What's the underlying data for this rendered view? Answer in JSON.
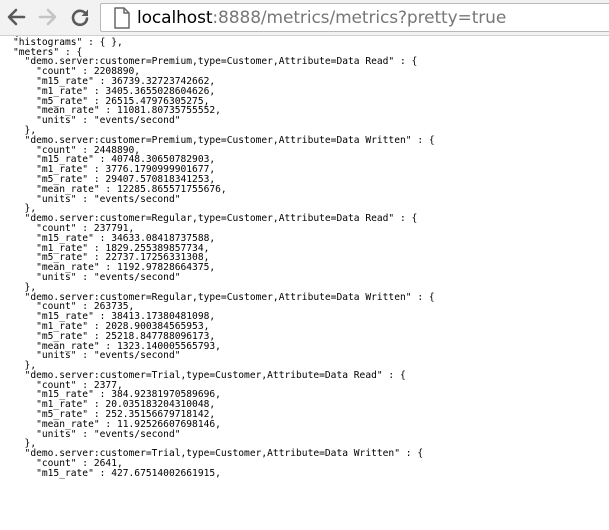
{
  "browser": {
    "url_host": "localhost",
    "url_rest": ":8888/metrics/metrics?pretty=true",
    "back_icon": "back-arrow-icon",
    "forward_icon": "forward-arrow-icon",
    "reload_icon": "reload-icon",
    "page_icon": "page-icon"
  },
  "content": {
    "lines": [
      "{",
      "\"histograms\" : { },",
      "\"meters\" : {",
      "  \"demo.server:customer=Premium,type=Customer,Attribute=Data Read\" : {",
      "    \"count\" : 2208890,",
      "    \"m15_rate\" : 36739.32723742662,",
      "    \"m1_rate\" : 3405.3655028604626,",
      "    \"m5_rate\" : 26515.47976305275,",
      "    \"mean_rate\" : 11081.80735755552,",
      "    \"units\" : \"events/second\"",
      "  },",
      "  \"demo.server:customer=Premium,type=Customer,Attribute=Data Written\" : {",
      "    \"count\" : 2448890,",
      "    \"m15_rate\" : 40748.30650782903,",
      "    \"m1_rate\" : 3776.1790999901677,",
      "    \"m5_rate\" : 29407.570818341253,",
      "    \"mean_rate\" : 12285.865571755676,",
      "    \"units\" : \"events/second\"",
      "  },",
      "  \"demo.server:customer=Regular,type=Customer,Attribute=Data Read\" : {",
      "    \"count\" : 237791,",
      "    \"m15_rate\" : 34633.08418737588,",
      "    \"m1_rate\" : 1829.255389857734,",
      "    \"m5_rate\" : 22737.17256331308,",
      "    \"mean_rate\" : 1192.97828664375,",
      "    \"units\" : \"events/second\"",
      "  },",
      "  \"demo.server:customer=Regular,type=Customer,Attribute=Data Written\" : {",
      "    \"count\" : 263735,",
      "    \"m15_rate\" : 38413.17380481098,",
      "    \"m1_rate\" : 2028.900384565953,",
      "    \"m5_rate\" : 25218.847788096173,",
      "    \"mean_rate\" : 1323.140005565793,",
      "    \"units\" : \"events/second\"",
      "  },",
      "  \"demo.server:customer=Trial,type=Customer,Attribute=Data Read\" : {",
      "    \"count\" : 2377,",
      "    \"m15_rate\" : 384.92381970589696,",
      "    \"m1_rate\" : 20.035183204310048,",
      "    \"m5_rate\" : 252.35156679718142,",
      "    \"mean_rate\" : 11.92526607698146,",
      "    \"units\" : \"events/second\"",
      "  },",
      "  \"demo.server:customer=Trial,type=Customer,Attribute=Data Written\" : {",
      "    \"count\" : 2641,",
      "    \"m15_rate\" : 427.67514002661915,"
    ]
  }
}
